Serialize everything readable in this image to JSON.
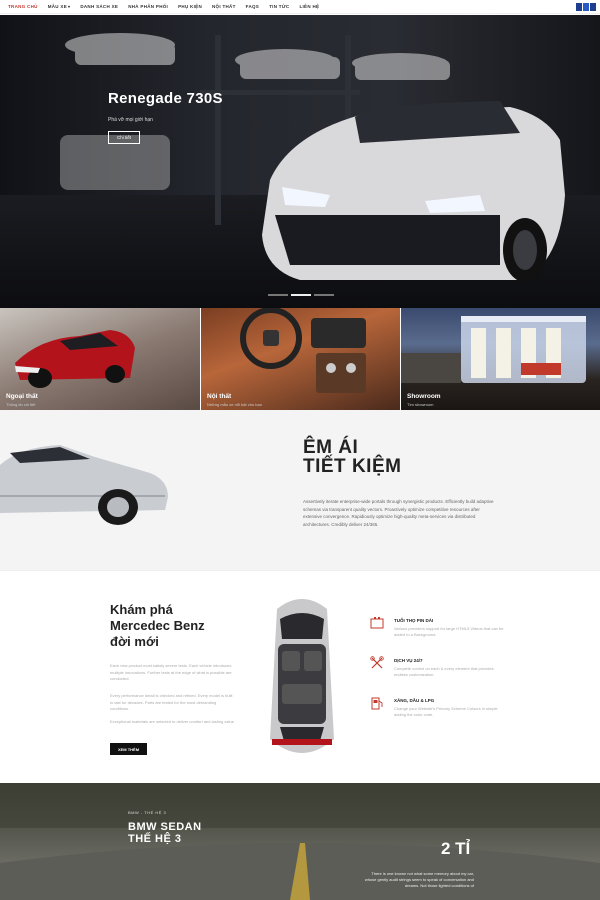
{
  "nav": {
    "items": [
      {
        "label": "TRANG CHỦ",
        "active": true
      },
      {
        "label": "MẪU XE",
        "caret": "▾"
      },
      {
        "label": "DANH SÁCH XE"
      },
      {
        "label": "NHÀ PHÂN PHỐI"
      },
      {
        "label": "PHỤ KIỆN"
      },
      {
        "label": "NỘI THẤT"
      },
      {
        "label": "FAQS"
      },
      {
        "label": "TIN TỨC"
      },
      {
        "label": "LIÊN HỆ"
      }
    ],
    "flag_icon": "language-flag-icon"
  },
  "hero": {
    "title": "Renegade 730S",
    "subtitle": "Phá vỡ mọi giới hạn",
    "button": "Chi tiết",
    "slides_total": 3,
    "slide_active": 2
  },
  "categories": [
    {
      "label": "Ngoại thất",
      "sub": "Thông tin chi tiết"
    },
    {
      "label": "Nội thất",
      "sub": "Những mẫu xe nổi bật cho bạn"
    },
    {
      "label": "Showroom",
      "sub": "Tìm showroom"
    }
  ],
  "feature1": {
    "title_line1": "ÊM ÁI",
    "title_line2": "TIẾT KIỆM",
    "text": "Assertively iterate enterprise-wide portals through synergistic products. Efficiently build adaptive schemas via transparent quality vectors. Proactively optimize competitive resources after extensive convergence. Rapidiously optimize high-quality meta-services via distributed architectures. Credibly deliver 24/365."
  },
  "feature2": {
    "title_line1": "Khám phá",
    "title_line2": "Mercedec Benz",
    "title_line3": "đời mới",
    "paragraphs": [
      "Each new product must satisfy severe tests. Each vehicle introduces multiple innovations. Further tests at the edge of what is possible are conducted.",
      "Every performance detail is checked and refined. Every model is built to last for decades. Parts are tested for the most demanding conditions.",
      "Exceptional materials are selected to deliver comfort and lasting value."
    ],
    "button": "XEM THÊM",
    "services": [
      {
        "title": "TUỔI THỌ PIN DÀI",
        "text": "Various providers support for large HTML5 Videos that can be added to a Background.",
        "icon": "battery-icon"
      },
      {
        "title": "DỊCH VỤ 24/7",
        "text": "Complete control on each & every element that provides endless customization.",
        "icon": "wrench-icon"
      },
      {
        "title": "XĂNG, DẦU & LPG",
        "text": "Change your Website's Primary Scheme Colours in simple adding the color code.",
        "icon": "fuel-pump-icon"
      }
    ]
  },
  "bmw": {
    "kicker": "BMW - THẾ HỆ 3",
    "title_line1": "BMW SEDAN",
    "title_line2": "THẾ HỆ 3",
    "price": "2 TỈ",
    "text": "There is one known not what some memory about my car, whose gently audit strings seem to speak of conversation and dreams. Not those lighted conditions of"
  },
  "colors": {
    "accent": "#c0392b",
    "dark": "#111111",
    "light_bg": "#f4f4f4"
  }
}
